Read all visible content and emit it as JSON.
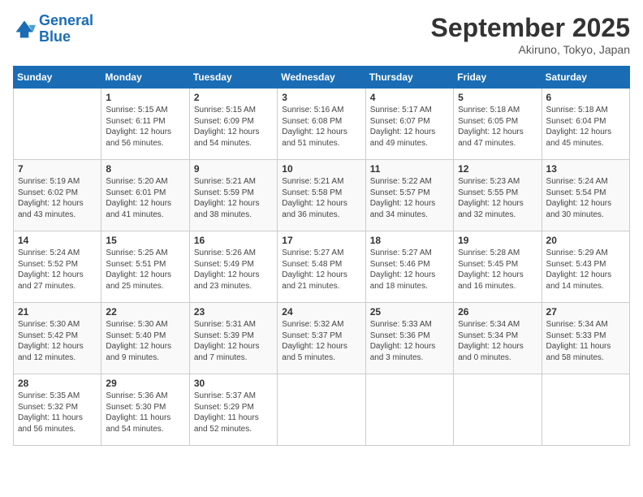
{
  "header": {
    "logo_line1": "General",
    "logo_line2": "Blue",
    "month": "September 2025",
    "location": "Akiruno, Tokyo, Japan"
  },
  "days_of_week": [
    "Sunday",
    "Monday",
    "Tuesday",
    "Wednesday",
    "Thursday",
    "Friday",
    "Saturday"
  ],
  "weeks": [
    [
      {
        "day": "",
        "info": ""
      },
      {
        "day": "1",
        "info": "Sunrise: 5:15 AM\nSunset: 6:11 PM\nDaylight: 12 hours\nand 56 minutes."
      },
      {
        "day": "2",
        "info": "Sunrise: 5:15 AM\nSunset: 6:09 PM\nDaylight: 12 hours\nand 54 minutes."
      },
      {
        "day": "3",
        "info": "Sunrise: 5:16 AM\nSunset: 6:08 PM\nDaylight: 12 hours\nand 51 minutes."
      },
      {
        "day": "4",
        "info": "Sunrise: 5:17 AM\nSunset: 6:07 PM\nDaylight: 12 hours\nand 49 minutes."
      },
      {
        "day": "5",
        "info": "Sunrise: 5:18 AM\nSunset: 6:05 PM\nDaylight: 12 hours\nand 47 minutes."
      },
      {
        "day": "6",
        "info": "Sunrise: 5:18 AM\nSunset: 6:04 PM\nDaylight: 12 hours\nand 45 minutes."
      }
    ],
    [
      {
        "day": "7",
        "info": "Sunrise: 5:19 AM\nSunset: 6:02 PM\nDaylight: 12 hours\nand 43 minutes."
      },
      {
        "day": "8",
        "info": "Sunrise: 5:20 AM\nSunset: 6:01 PM\nDaylight: 12 hours\nand 41 minutes."
      },
      {
        "day": "9",
        "info": "Sunrise: 5:21 AM\nSunset: 5:59 PM\nDaylight: 12 hours\nand 38 minutes."
      },
      {
        "day": "10",
        "info": "Sunrise: 5:21 AM\nSunset: 5:58 PM\nDaylight: 12 hours\nand 36 minutes."
      },
      {
        "day": "11",
        "info": "Sunrise: 5:22 AM\nSunset: 5:57 PM\nDaylight: 12 hours\nand 34 minutes."
      },
      {
        "day": "12",
        "info": "Sunrise: 5:23 AM\nSunset: 5:55 PM\nDaylight: 12 hours\nand 32 minutes."
      },
      {
        "day": "13",
        "info": "Sunrise: 5:24 AM\nSunset: 5:54 PM\nDaylight: 12 hours\nand 30 minutes."
      }
    ],
    [
      {
        "day": "14",
        "info": "Sunrise: 5:24 AM\nSunset: 5:52 PM\nDaylight: 12 hours\nand 27 minutes."
      },
      {
        "day": "15",
        "info": "Sunrise: 5:25 AM\nSunset: 5:51 PM\nDaylight: 12 hours\nand 25 minutes."
      },
      {
        "day": "16",
        "info": "Sunrise: 5:26 AM\nSunset: 5:49 PM\nDaylight: 12 hours\nand 23 minutes."
      },
      {
        "day": "17",
        "info": "Sunrise: 5:27 AM\nSunset: 5:48 PM\nDaylight: 12 hours\nand 21 minutes."
      },
      {
        "day": "18",
        "info": "Sunrise: 5:27 AM\nSunset: 5:46 PM\nDaylight: 12 hours\nand 18 minutes."
      },
      {
        "day": "19",
        "info": "Sunrise: 5:28 AM\nSunset: 5:45 PM\nDaylight: 12 hours\nand 16 minutes."
      },
      {
        "day": "20",
        "info": "Sunrise: 5:29 AM\nSunset: 5:43 PM\nDaylight: 12 hours\nand 14 minutes."
      }
    ],
    [
      {
        "day": "21",
        "info": "Sunrise: 5:30 AM\nSunset: 5:42 PM\nDaylight: 12 hours\nand 12 minutes."
      },
      {
        "day": "22",
        "info": "Sunrise: 5:30 AM\nSunset: 5:40 PM\nDaylight: 12 hours\nand 9 minutes."
      },
      {
        "day": "23",
        "info": "Sunrise: 5:31 AM\nSunset: 5:39 PM\nDaylight: 12 hours\nand 7 minutes."
      },
      {
        "day": "24",
        "info": "Sunrise: 5:32 AM\nSunset: 5:37 PM\nDaylight: 12 hours\nand 5 minutes."
      },
      {
        "day": "25",
        "info": "Sunrise: 5:33 AM\nSunset: 5:36 PM\nDaylight: 12 hours\nand 3 minutes."
      },
      {
        "day": "26",
        "info": "Sunrise: 5:34 AM\nSunset: 5:34 PM\nDaylight: 12 hours\nand 0 minutes."
      },
      {
        "day": "27",
        "info": "Sunrise: 5:34 AM\nSunset: 5:33 PM\nDaylight: 11 hours\nand 58 minutes."
      }
    ],
    [
      {
        "day": "28",
        "info": "Sunrise: 5:35 AM\nSunset: 5:32 PM\nDaylight: 11 hours\nand 56 minutes."
      },
      {
        "day": "29",
        "info": "Sunrise: 5:36 AM\nSunset: 5:30 PM\nDaylight: 11 hours\nand 54 minutes."
      },
      {
        "day": "30",
        "info": "Sunrise: 5:37 AM\nSunset: 5:29 PM\nDaylight: 11 hours\nand 52 minutes."
      },
      {
        "day": "",
        "info": ""
      },
      {
        "day": "",
        "info": ""
      },
      {
        "day": "",
        "info": ""
      },
      {
        "day": "",
        "info": ""
      }
    ]
  ]
}
